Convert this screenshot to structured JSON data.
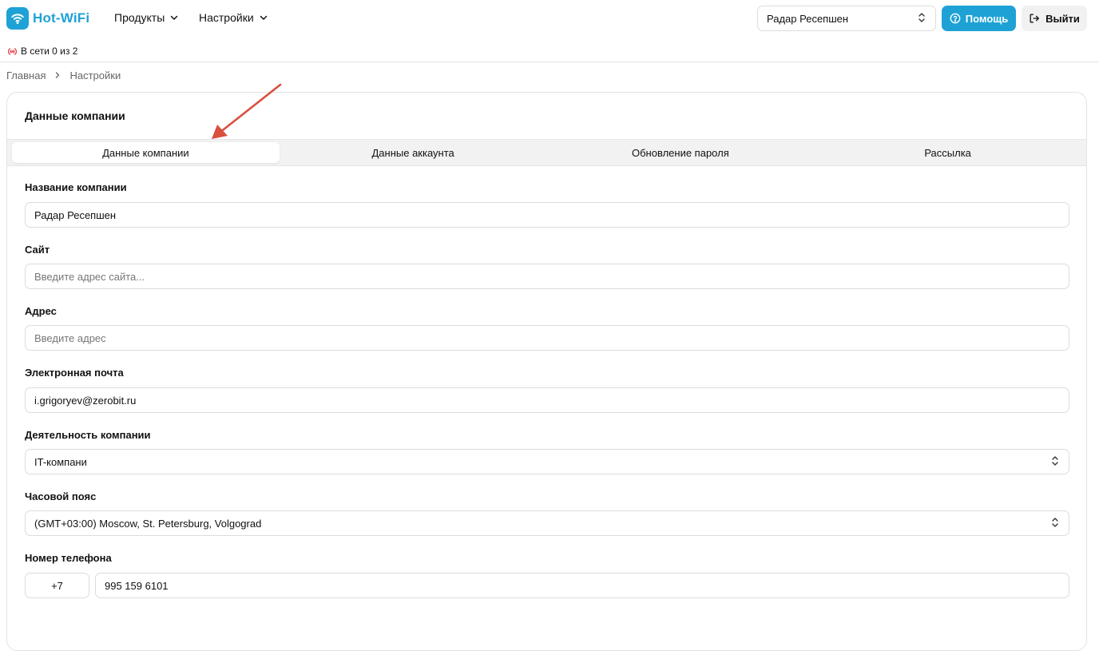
{
  "header": {
    "logo_text": "Hot-WiFi",
    "brand_color": "#1ea2d6",
    "menus": [
      {
        "label": "Продукты",
        "icon": "chevron-down-icon"
      },
      {
        "label": "Настройки",
        "icon": "chevron-down-icon"
      }
    ],
    "company_select": "Радар Ресепшен",
    "help_label": "Помощь",
    "logout_label": "Выйти"
  },
  "status": {
    "text": "В сети 0 из 2",
    "icon": "offline-signal-icon",
    "color": "#e5484d"
  },
  "breadcrumb": [
    "Главная",
    "Настройки"
  ],
  "card": {
    "title": "Данные компании",
    "tabs": [
      {
        "label": "Данные компании",
        "active": true
      },
      {
        "label": "Данные аккаунта",
        "active": false
      },
      {
        "label": "Обновление пароля",
        "active": false
      },
      {
        "label": "Рассылка",
        "active": false
      }
    ],
    "fields": {
      "company_name": {
        "label": "Название компании",
        "value": "Радар Ресепшен"
      },
      "site": {
        "label": "Сайт",
        "value": "",
        "placeholder": "Введите адрес сайта..."
      },
      "address": {
        "label": "Адрес",
        "value": "",
        "placeholder": "Введите адрес"
      },
      "email": {
        "label": "Электронная почта",
        "value": "i.grigoryev@zerobit.ru"
      },
      "activity": {
        "label": "Деятельность компании",
        "value": "IT-компани"
      },
      "timezone": {
        "label": "Часовой пояс",
        "value": "(GMT+03:00) Moscow, St. Petersburg, Volgograd"
      },
      "phone": {
        "label": "Номер телефона",
        "code": "+7",
        "value": "995 159 6101"
      }
    }
  },
  "annotation_color": "#d9503f"
}
